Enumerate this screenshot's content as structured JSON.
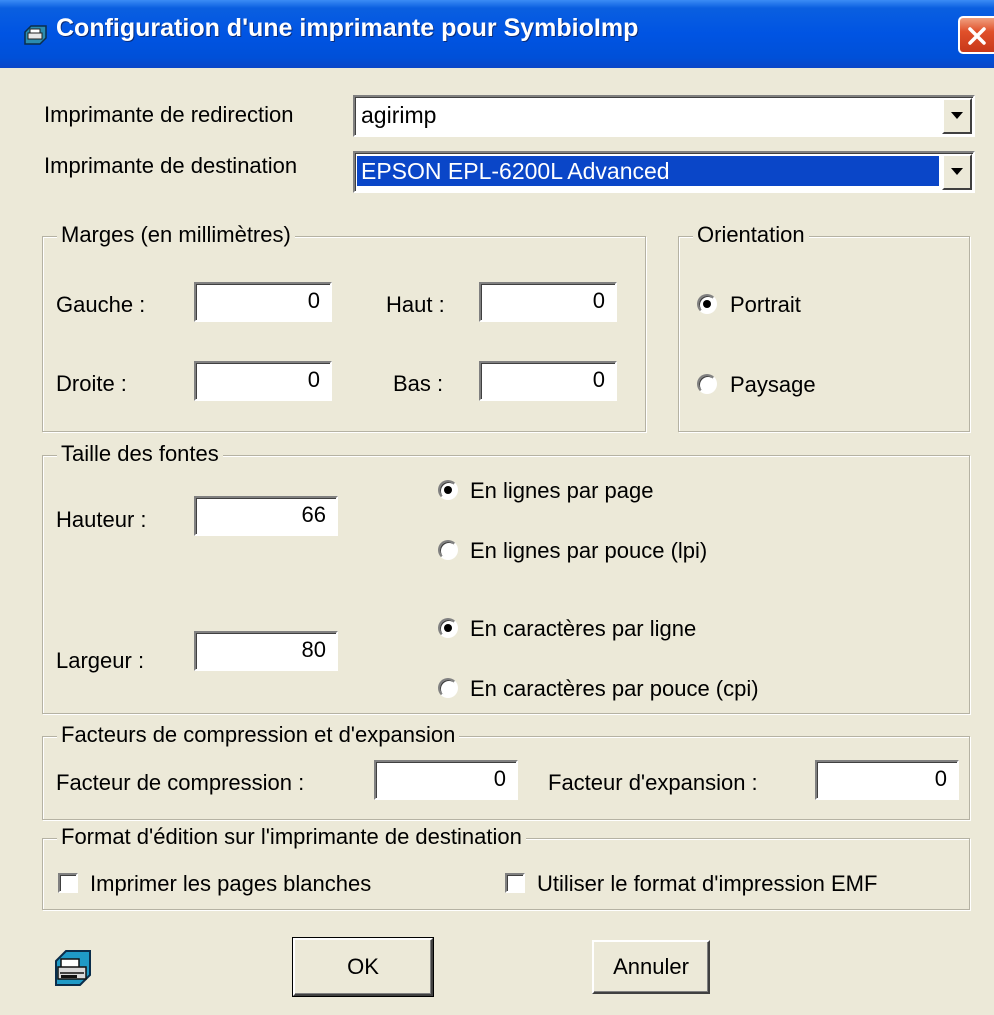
{
  "window": {
    "title": "Configuration d'une imprimante pour SymbioImp",
    "title_icon": "printer-app-icon",
    "close_icon": "close-icon",
    "close_color": "#e0502a"
  },
  "printers": {
    "redirection_label": "Imprimante de redirection",
    "redirection_value": "agirimp",
    "destination_label": "Imprimante de destination",
    "destination_value": "EPSON EPL-6200L Advanced"
  },
  "margins": {
    "legend": "Marges (en millimètres)",
    "left_label": "Gauche :",
    "left_value": "0",
    "top_label": "Haut :",
    "top_value": "0",
    "right_label": "Droite :",
    "right_value": "0",
    "bottom_label": "Bas :",
    "bottom_value": "0"
  },
  "orientation": {
    "legend": "Orientation",
    "options": [
      {
        "label": "Portrait",
        "selected": true
      },
      {
        "label": "Paysage",
        "selected": false
      }
    ]
  },
  "font_size": {
    "legend": "Taille des fontes",
    "height_label": "Hauteur :",
    "height_value": "66",
    "width_label": "Largeur :",
    "width_value": "80",
    "height_options": [
      {
        "label": "En lignes par page",
        "selected": true
      },
      {
        "label": "En lignes par pouce (lpi)",
        "selected": false
      }
    ],
    "width_options": [
      {
        "label": "En caractères par ligne",
        "selected": true
      },
      {
        "label": "En caractères par pouce (cpi)",
        "selected": false
      }
    ]
  },
  "factors": {
    "legend": "Facteurs de compression et d'expansion",
    "compression_label": "Facteur de compression :",
    "compression_value": "0",
    "expansion_label": "Facteur d'expansion :",
    "expansion_value": "0"
  },
  "format": {
    "legend": "Format d'édition sur l'imprimante de destination",
    "blank_pages_label": "Imprimer les pages blanches",
    "blank_pages_checked": false,
    "emf_label": "Utiliser le format d'impression EMF",
    "emf_checked": false
  },
  "buttons": {
    "ok": "OK",
    "cancel": "Annuler",
    "printer_icon": "printer-icon"
  },
  "colors": {
    "face": "#ece9d8",
    "title_blue": "#0054e3",
    "selection": "#0a46c8"
  }
}
